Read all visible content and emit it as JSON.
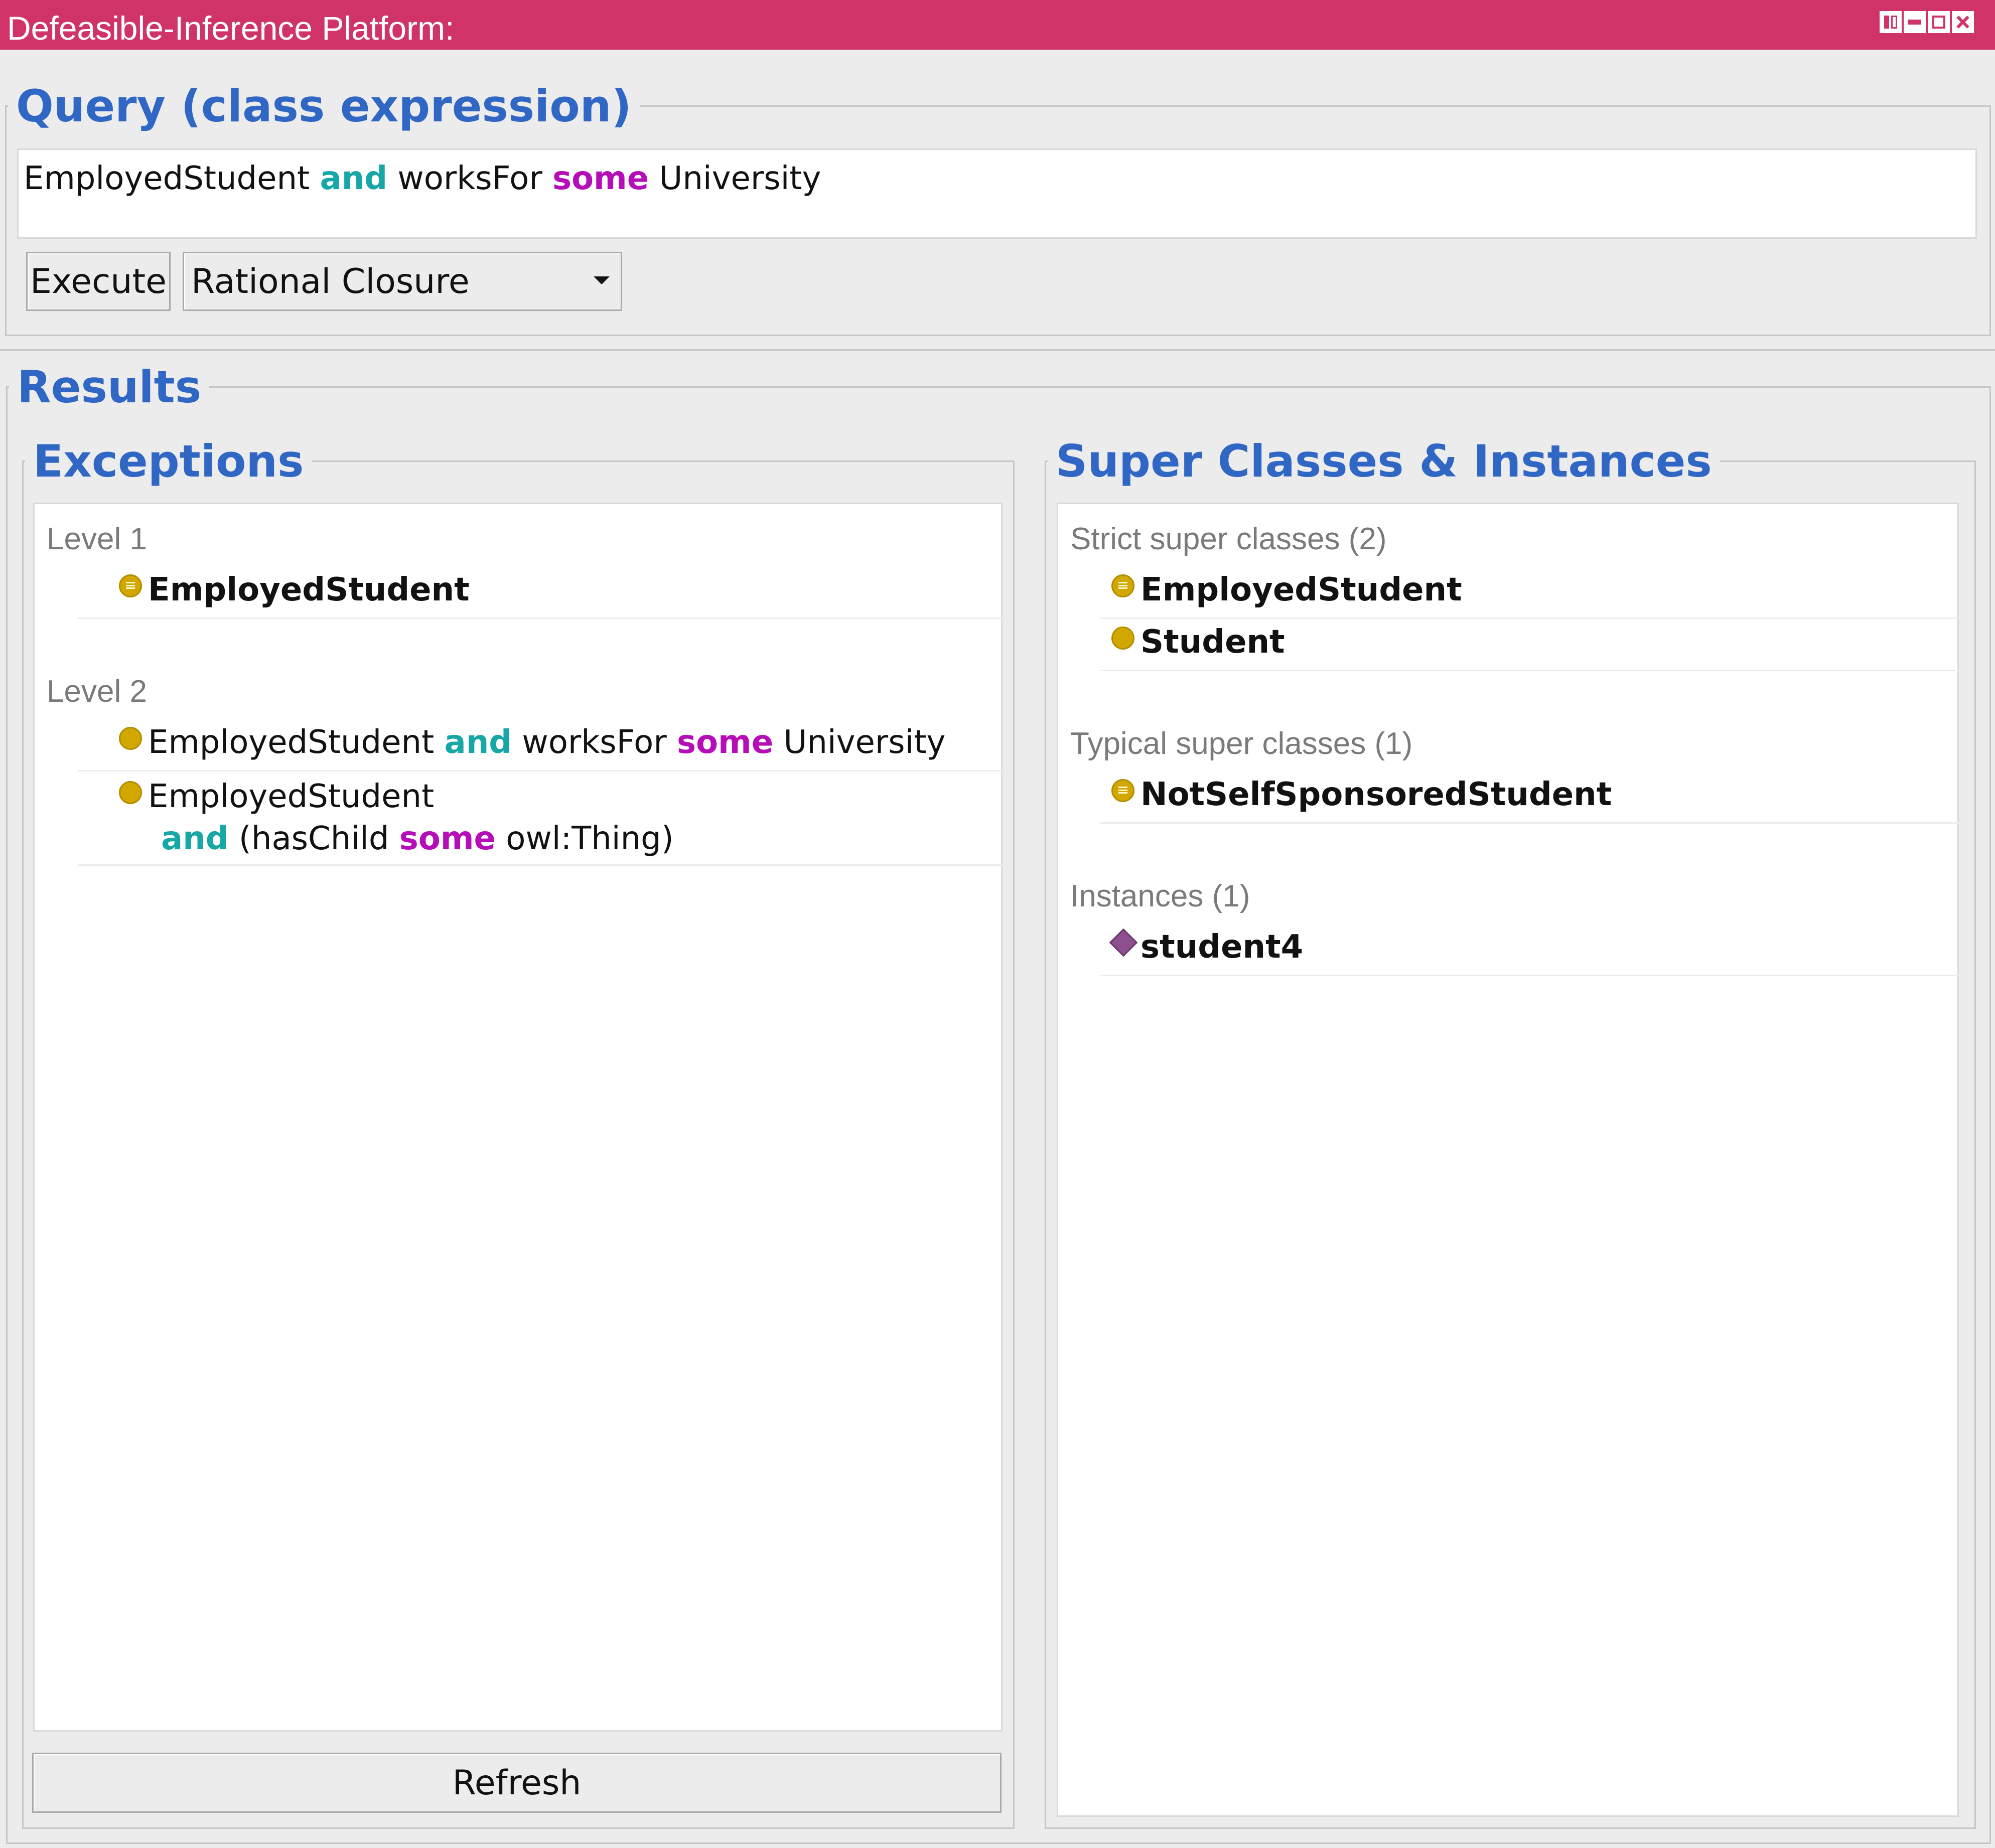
{
  "window": {
    "title": "Defeasible-Inference Platform:",
    "controls": [
      "panel-layout-icon",
      "minimize-icon",
      "maximize-icon",
      "close-icon"
    ]
  },
  "query": {
    "legend": "Query (class expression)",
    "expression": {
      "t1": "EmployedStudent",
      "k1": "and",
      "t2": "worksFor",
      "k2": "some",
      "t3": "University"
    },
    "execute_label": "Execute",
    "reasoner_selected": "Rational Closure"
  },
  "results": {
    "legend": "Results",
    "exceptions": {
      "legend": "Exceptions",
      "level1": {
        "label": "Level 1",
        "items": [
          {
            "text": "EmployedStudent"
          }
        ]
      },
      "level2": {
        "label": "Level 2",
        "items": [
          {
            "t1": "EmployedStudent",
            "k1": "and",
            "t2": "worksFor",
            "k2": "some",
            "t3": "University"
          },
          {
            "t1": "EmployedStudent",
            "k1": "and",
            "t2": "(hasChild",
            "k2": "some",
            "t3": "owl:Thing)"
          }
        ]
      },
      "refresh_label": "Refresh"
    },
    "superclasses": {
      "legend": "Super Classes & Instances",
      "strict": {
        "label": "Strict super classes (2)",
        "items": [
          {
            "text": "EmployedStudent"
          },
          {
            "text": "Student"
          }
        ]
      },
      "typical": {
        "label": "Typical super classes (1)",
        "items": [
          {
            "text": "NotSelfSponsoredStudent"
          }
        ]
      },
      "instances": {
        "label": "Instances (1)",
        "items": [
          {
            "text": "student4"
          }
        ]
      }
    }
  },
  "colors": {
    "titlebar": "#cf3368",
    "legend": "#3066c4",
    "keyword_and": "#17a7a7",
    "keyword_some": "#b50db8",
    "class_icon": "#d2a700",
    "individual_icon": "#8d4f8e"
  }
}
